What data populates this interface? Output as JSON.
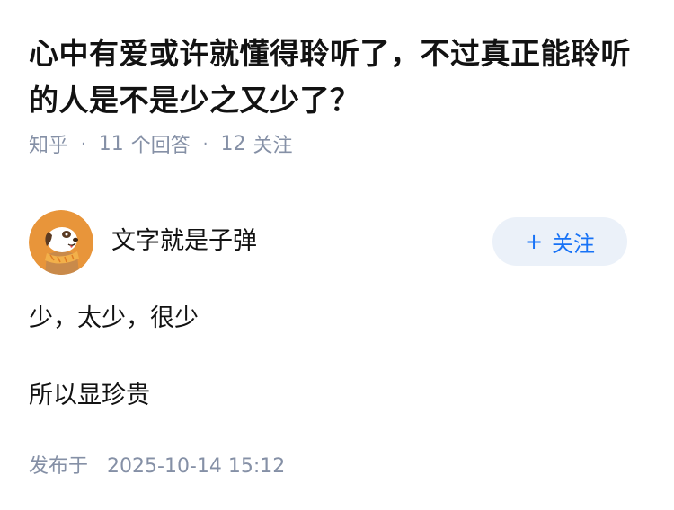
{
  "question": {
    "title": "心中有爱或许就懂得聆听了，不过真正能聆听的人是不是少之又少了？",
    "source": "知乎",
    "separator": "·",
    "answer_count": "11",
    "answer_label": "个回答",
    "follower_count": "12",
    "follower_label": "关注"
  },
  "answer": {
    "author_name": "文字就是子弹",
    "avatar_icon": "dog-avatar-icon",
    "follow_button": {
      "plus": "+",
      "label": "关注"
    },
    "paragraphs": [
      "少，太少，很少",
      "所以显珍贵"
    ],
    "publish_label": "发布于",
    "publish_time": "2025-10-14 15:12"
  },
  "colors": {
    "title": "#121212",
    "meta": "#8590a6",
    "accent": "#1772f6",
    "follow_bg": "#ebf1f9",
    "avatar_bg": "#e8953a"
  }
}
